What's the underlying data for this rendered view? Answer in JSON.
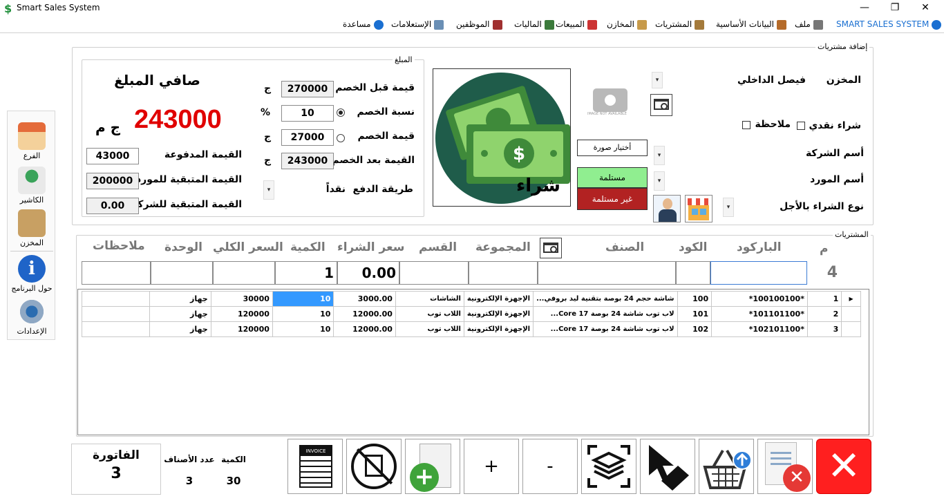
{
  "window": {
    "title": "Smart Sales System",
    "minimize": "—",
    "maximize": "❐",
    "close": "✕"
  },
  "menu": {
    "brand": "SMART SALES SYSTEM",
    "items": [
      "ملف",
      "البيانات الأساسية",
      "المشتريات",
      "المخازن",
      "المبيعات",
      "الماليات",
      "الموظفين",
      "الإستعلامات",
      "مساعدة"
    ]
  },
  "sidebar": {
    "items": [
      "الفرع",
      "الكاشير",
      "المخزن",
      "حول البرنامج",
      "الإعدادات"
    ]
  },
  "amount_box": {
    "label": "المبلغ",
    "net_title": "صافي المبلغ",
    "net_value": "243000",
    "currency_big": "ج م",
    "before_discount_label": "قيمة قبل الخصم",
    "before_discount_value": "270000",
    "discount_pct_label": "نسبة الخصم",
    "discount_pct_value": "10",
    "discount_value_label": "قيمة الخصم",
    "discount_value_value": "27000",
    "after_discount_label": "القيمة بعد الخصم",
    "after_discount_value": "243000",
    "currency_short": "ج",
    "pct_symbol": "%",
    "paid_label": "القيمة المدفوعة",
    "paid_value": "43000",
    "remaining_supplier_label": "القيمة المتبقية للمورد",
    "remaining_supplier_value": "200000",
    "remaining_company_label": "القيمة المتبقية للشركة",
    "remaining_company_value": "0.00",
    "payment_method_label": "طريقة الدفع",
    "payment_method_value": "نقداً"
  },
  "purchase_add": {
    "label": "إضافة مشتريات",
    "store_label": "المخزن",
    "store_value": "فيصل الداخلي",
    "cash_purchase_label": "شراء نقدي",
    "note_label": "ملاحظة",
    "company_label": "أسم الشركة",
    "supplier_label": "أسم المورد",
    "purchase_type_label": "نوع الشراء بالأجل",
    "choose_image": "أختيار صورة",
    "received": "مستلمة",
    "not_received": "غير مستلمة",
    "no_image_text": "IMAGE NOT AVAILABLE",
    "buy_caption": "شراء",
    "colors": {
      "received_bg": "#90ee90",
      "not_received_bg": "#b22222",
      "net_value_color": "#e00000"
    }
  },
  "purchases": {
    "label": "المشتريات",
    "headers": [
      "م",
      "الباركود",
      "الكود",
      "الصنف",
      "المجموعة",
      "القسم",
      "سعر الشراء",
      "الكمية",
      "السعر الكلي",
      "الوحدة",
      "ملاحظات"
    ],
    "entry": {
      "row_no": "4",
      "price": "0.00",
      "qty": "1"
    },
    "rows": [
      {
        "no": "1",
        "barcode": "*100100100*",
        "code": "100",
        "item": "شاشة حجم 24 بوصة بتقنية ليد بروفي...",
        "group": "الإجهزة الإلكترونية",
        "section": "الشاشات",
        "price": "3000.00",
        "qty": "10",
        "total": "30000",
        "unit": "جهاز",
        "notes": ""
      },
      {
        "no": "2",
        "barcode": "*101101100*",
        "code": "101",
        "item": "لاب توب شاشة 24 بوصة Core 17...",
        "group": "الإجهزة الإلكترونية",
        "section": "اللاب توب",
        "price": "12000.00",
        "qty": "10",
        "total": "120000",
        "unit": "جهاز",
        "notes": ""
      },
      {
        "no": "3",
        "barcode": "*102101100*",
        "code": "102",
        "item": "لاب توب شاشة 24 بوصة Core 17...",
        "group": "الإجهزة الإلكترونية",
        "section": "اللاب توب",
        "price": "12000.00",
        "qty": "10",
        "total": "120000",
        "unit": "جهاز",
        "notes": ""
      }
    ]
  },
  "footer": {
    "invoice_label": "الفاتورة",
    "invoice_value": "3",
    "items_count_label": "عدد الأصناف",
    "items_count_value": "3",
    "qty_label": "الكمية",
    "qty_value": "30",
    "plus": "+",
    "minus": "-",
    "invoice_icon_text": "INVOICE"
  }
}
